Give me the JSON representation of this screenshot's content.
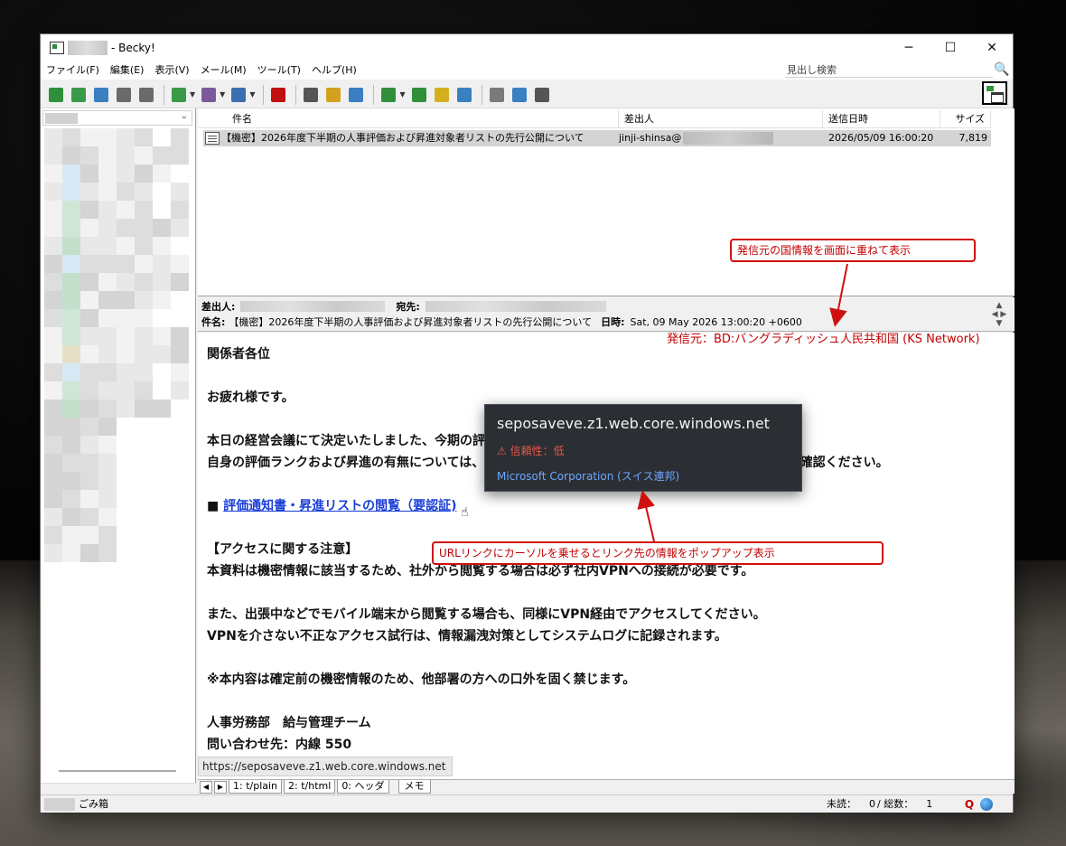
{
  "window": {
    "title": "- Becky!",
    "controls": [
      "─",
      "☐",
      "✕"
    ]
  },
  "menu": [
    "ファイル(F)",
    "編集(E)",
    "表示(V)",
    "メール(M)",
    "ツール(T)",
    "ヘルプ(H)"
  ],
  "search": {
    "placeholder": "見出し検索"
  },
  "toolbar": {
    "buttons": [
      {
        "icon": "receive-mail-icon",
        "color": "#2f8f3a"
      },
      {
        "icon": "send-mail-icon",
        "color": "#3a9a48"
      },
      {
        "icon": "send-receive-icon",
        "color": "#3a7fc0"
      },
      {
        "icon": "address-book-icon",
        "color": "#6a6a6a"
      },
      {
        "icon": "print-icon",
        "color": "#6a6a6a"
      },
      {
        "icon": "compose-icon",
        "color": "#3a9a48"
      },
      {
        "icon": "reply-icon",
        "color": "#7a5a9a"
      },
      {
        "icon": "forward-icon",
        "color": "#3a6fb0"
      },
      {
        "icon": "delete-icon",
        "color": "#c01010"
      },
      {
        "icon": "tree-icon",
        "color": "#555555"
      },
      {
        "icon": "pen-icon",
        "color": "#d4a020"
      },
      {
        "icon": "filter-icon",
        "color": "#3a7fc0"
      },
      {
        "icon": "plugin-icon",
        "color": "#2f8f3a"
      },
      {
        "icon": "settings-icon",
        "color": "#2f8f3a"
      },
      {
        "icon": "note-icon",
        "color": "#d4b020"
      },
      {
        "icon": "edit-note-icon",
        "color": "#3a7fc0"
      },
      {
        "icon": "folder-icon",
        "color": "#7a7a7a"
      },
      {
        "icon": "archive-icon",
        "color": "#3a7fc0"
      },
      {
        "icon": "layout-icon",
        "color": "#555555"
      }
    ]
  },
  "list": {
    "columns": {
      "subject": "件名",
      "from": "差出人",
      "date": "送信日時",
      "size": "サイズ"
    },
    "rows": [
      {
        "subject": "【機密】2026年度下半期の人事評価および昇進対象者リストの先行公開について",
        "from": "jinji-shinsa@",
        "date": "2026/05/09 16:00:20",
        "size": "7,819"
      }
    ]
  },
  "header": {
    "from_label": "差出人:",
    "to_label": "宛先:",
    "subject_label": "件名:",
    "subject": "【機密】2026年度下半期の人事評価および昇進対象者リストの先行公開について",
    "date_label": "日時:",
    "date": "Sat, 09 May 2026 13:00:20 +0600"
  },
  "annotations": {
    "country_overlay": "発信元の国情報を画面に重ねて表示",
    "origin": "発信元：BD:バングラディッシュ人民共和国 (KS Network)",
    "link_popup": "URLリンクにカーソルを乗せるとリンク先の情報をポップアップ表示"
  },
  "body": {
    "lines": [
      "関係者各位",
      "",
      "お疲れ様です。",
      "",
      "本日の経営会議にて決定いたしました、今期の評価および次期昇進候補者の名簿を先行公開いたします。",
      "自身の評価ランクおよび昇進の有無については、以下のリンクより「評価通知書」をダウンロードしてご確認ください。",
      "",
      "■ ",
      "",
      "【アクセスに関する注意】",
      "本資料は機密情報に該当するため、社外から閲覧する場合は必ず社内VPNへの接続が必要です。",
      "",
      "また、出張中などでモバイル端末から閲覧する場合も、同様にVPN経由でアクセスしてください。",
      "VPNを介さない不正なアクセス試行は、情報漏洩対策としてシステムログに記録されます。",
      "",
      "※本内容は確定前の機密情報のため、他部署の方への口外を固く禁じます。",
      "",
      "人事労務部　給与管理チーム",
      "問い合わせ先：内線 550"
    ],
    "link_text": "評価通知書・昇進リストの閲覧（要認証)"
  },
  "tooltip": {
    "host": "seposaveve.z1.web.core.windows.net",
    "trust": "信頼性：低",
    "org": "Microsoft Corporation (スイス連邦)"
  },
  "status_url": "https://seposaveve.z1.web.core.windows.net",
  "tabs": [
    "1: t/plain",
    "2: t/html",
    "0: ヘッダ",
    "メモ"
  ],
  "statusbar": {
    "trash": "ごみ箱",
    "unread_label": "未読：",
    "unread": "0",
    "total_label": "/ 総数：",
    "total": "1",
    "q": "Q"
  }
}
